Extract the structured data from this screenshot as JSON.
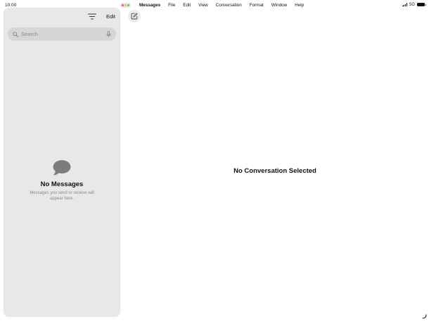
{
  "status_bar": {
    "time": "10:00",
    "network": "5G"
  },
  "traffic_lights": {
    "colors": [
      "#f05b55",
      "#f5bd4f",
      "#61c454"
    ]
  },
  "menu": {
    "items": [
      "Messages",
      "File",
      "Edit",
      "View",
      "Conversation",
      "Format",
      "Window",
      "Help"
    ]
  },
  "sidebar": {
    "edit_label": "Edit",
    "search_placeholder": "Search",
    "empty_title": "No Messages",
    "empty_subtitle": "Messages you send or receive will appear here."
  },
  "detail": {
    "title": "No Conversation Selected"
  },
  "icons": {
    "filter": "filter-icon",
    "search": "search-icon",
    "mic": "mic-icon",
    "bubble": "message-bubble-icon",
    "compose": "compose-icon"
  }
}
